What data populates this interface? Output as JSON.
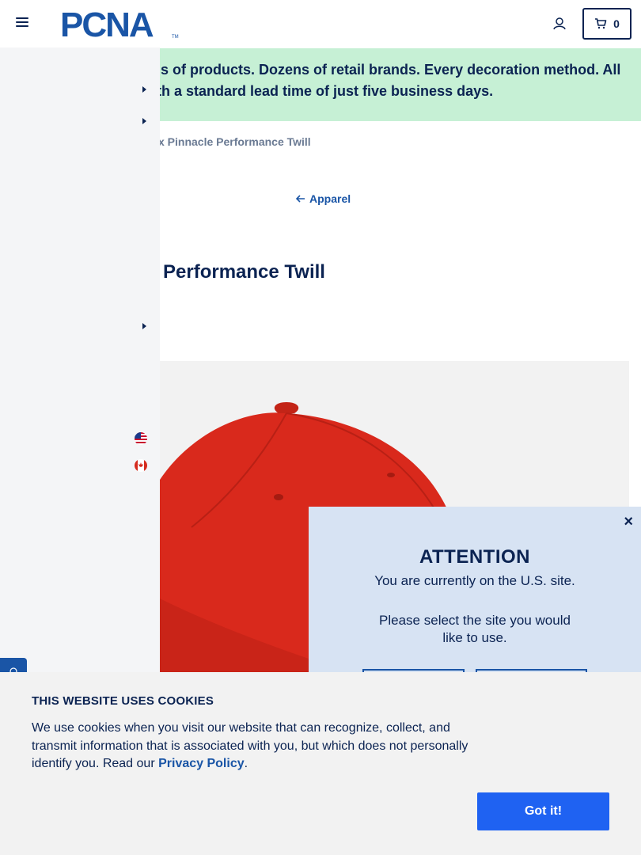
{
  "header": {
    "logo_text": "PCNA",
    "logo_tm": "TM",
    "cart_count": "0"
  },
  "promo": {
    "text_line1": "ls of products. Dozens of retail brands. Every decoration method. All",
    "text_line2": "th a standard lead time of just five business days."
  },
  "breadcrumb": {
    "current": "x Pinnacle Performance Twill"
  },
  "back_link": {
    "label": "Apparel"
  },
  "product": {
    "title": "Performance Twill",
    "image_color": "#d9291c"
  },
  "sidemenu": {
    "flags": [
      "us-flag-icon",
      "canada-flag-icon"
    ]
  },
  "modal": {
    "close_glyph": "×",
    "title": "ATTENTION",
    "text1": "You are currently on the U.S. site.",
    "text2": "Please select the site you would like to use."
  },
  "cookie": {
    "title": "THIS WEBSITE USES COOKIES",
    "text": "We use cookies when you visit our website that can recognize, collect, and transmit information that is associated with you, but which does not personally identify you. Read our ",
    "link": "Privacy Policy",
    "after_link": ".",
    "button": "Got it!"
  },
  "colors": {
    "navy": "#0b2352",
    "brand_blue": "#1a55a6",
    "promo_green": "#c6f0d5",
    "button_blue": "#1f62f2"
  }
}
